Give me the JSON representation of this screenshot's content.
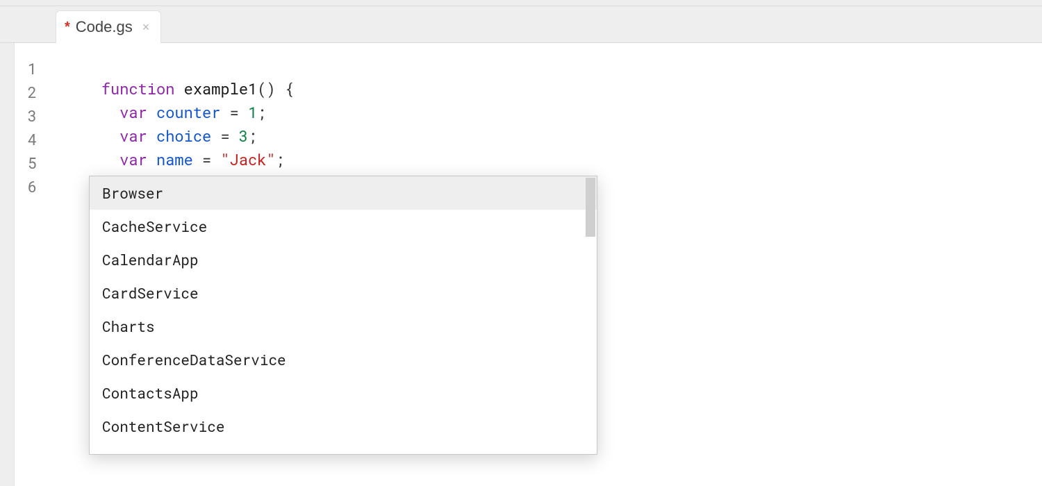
{
  "tab": {
    "modified_marker": "*",
    "filename": "Code.gs",
    "close_glyph": "×"
  },
  "gutter": [
    "1",
    "2",
    "3",
    "4",
    "5",
    "6"
  ],
  "code": {
    "l1": {
      "kw": "function",
      "name": "example1",
      "after": "() {"
    },
    "l2": {
      "indent": "  ",
      "kw": "var",
      "name": "counter",
      "eq": " = ",
      "val": "1",
      "end": ";"
    },
    "l3": {
      "indent": "  ",
      "kw": "var",
      "name": "choice",
      "eq": " = ",
      "val": "3",
      "end": ";"
    },
    "l4": {
      "indent": "  ",
      "kw": "var",
      "name": "name",
      "eq": " = ",
      "str": "\"Jack\"",
      "end": ";"
    },
    "l5": {
      "indent": "  "
    },
    "l6": {
      "text": "}"
    }
  },
  "autocomplete": {
    "items": [
      "Browser",
      "CacheService",
      "CalendarApp",
      "CardService",
      "Charts",
      "ConferenceDataService",
      "ContactsApp",
      "ContentService"
    ],
    "selected_index": 0
  }
}
